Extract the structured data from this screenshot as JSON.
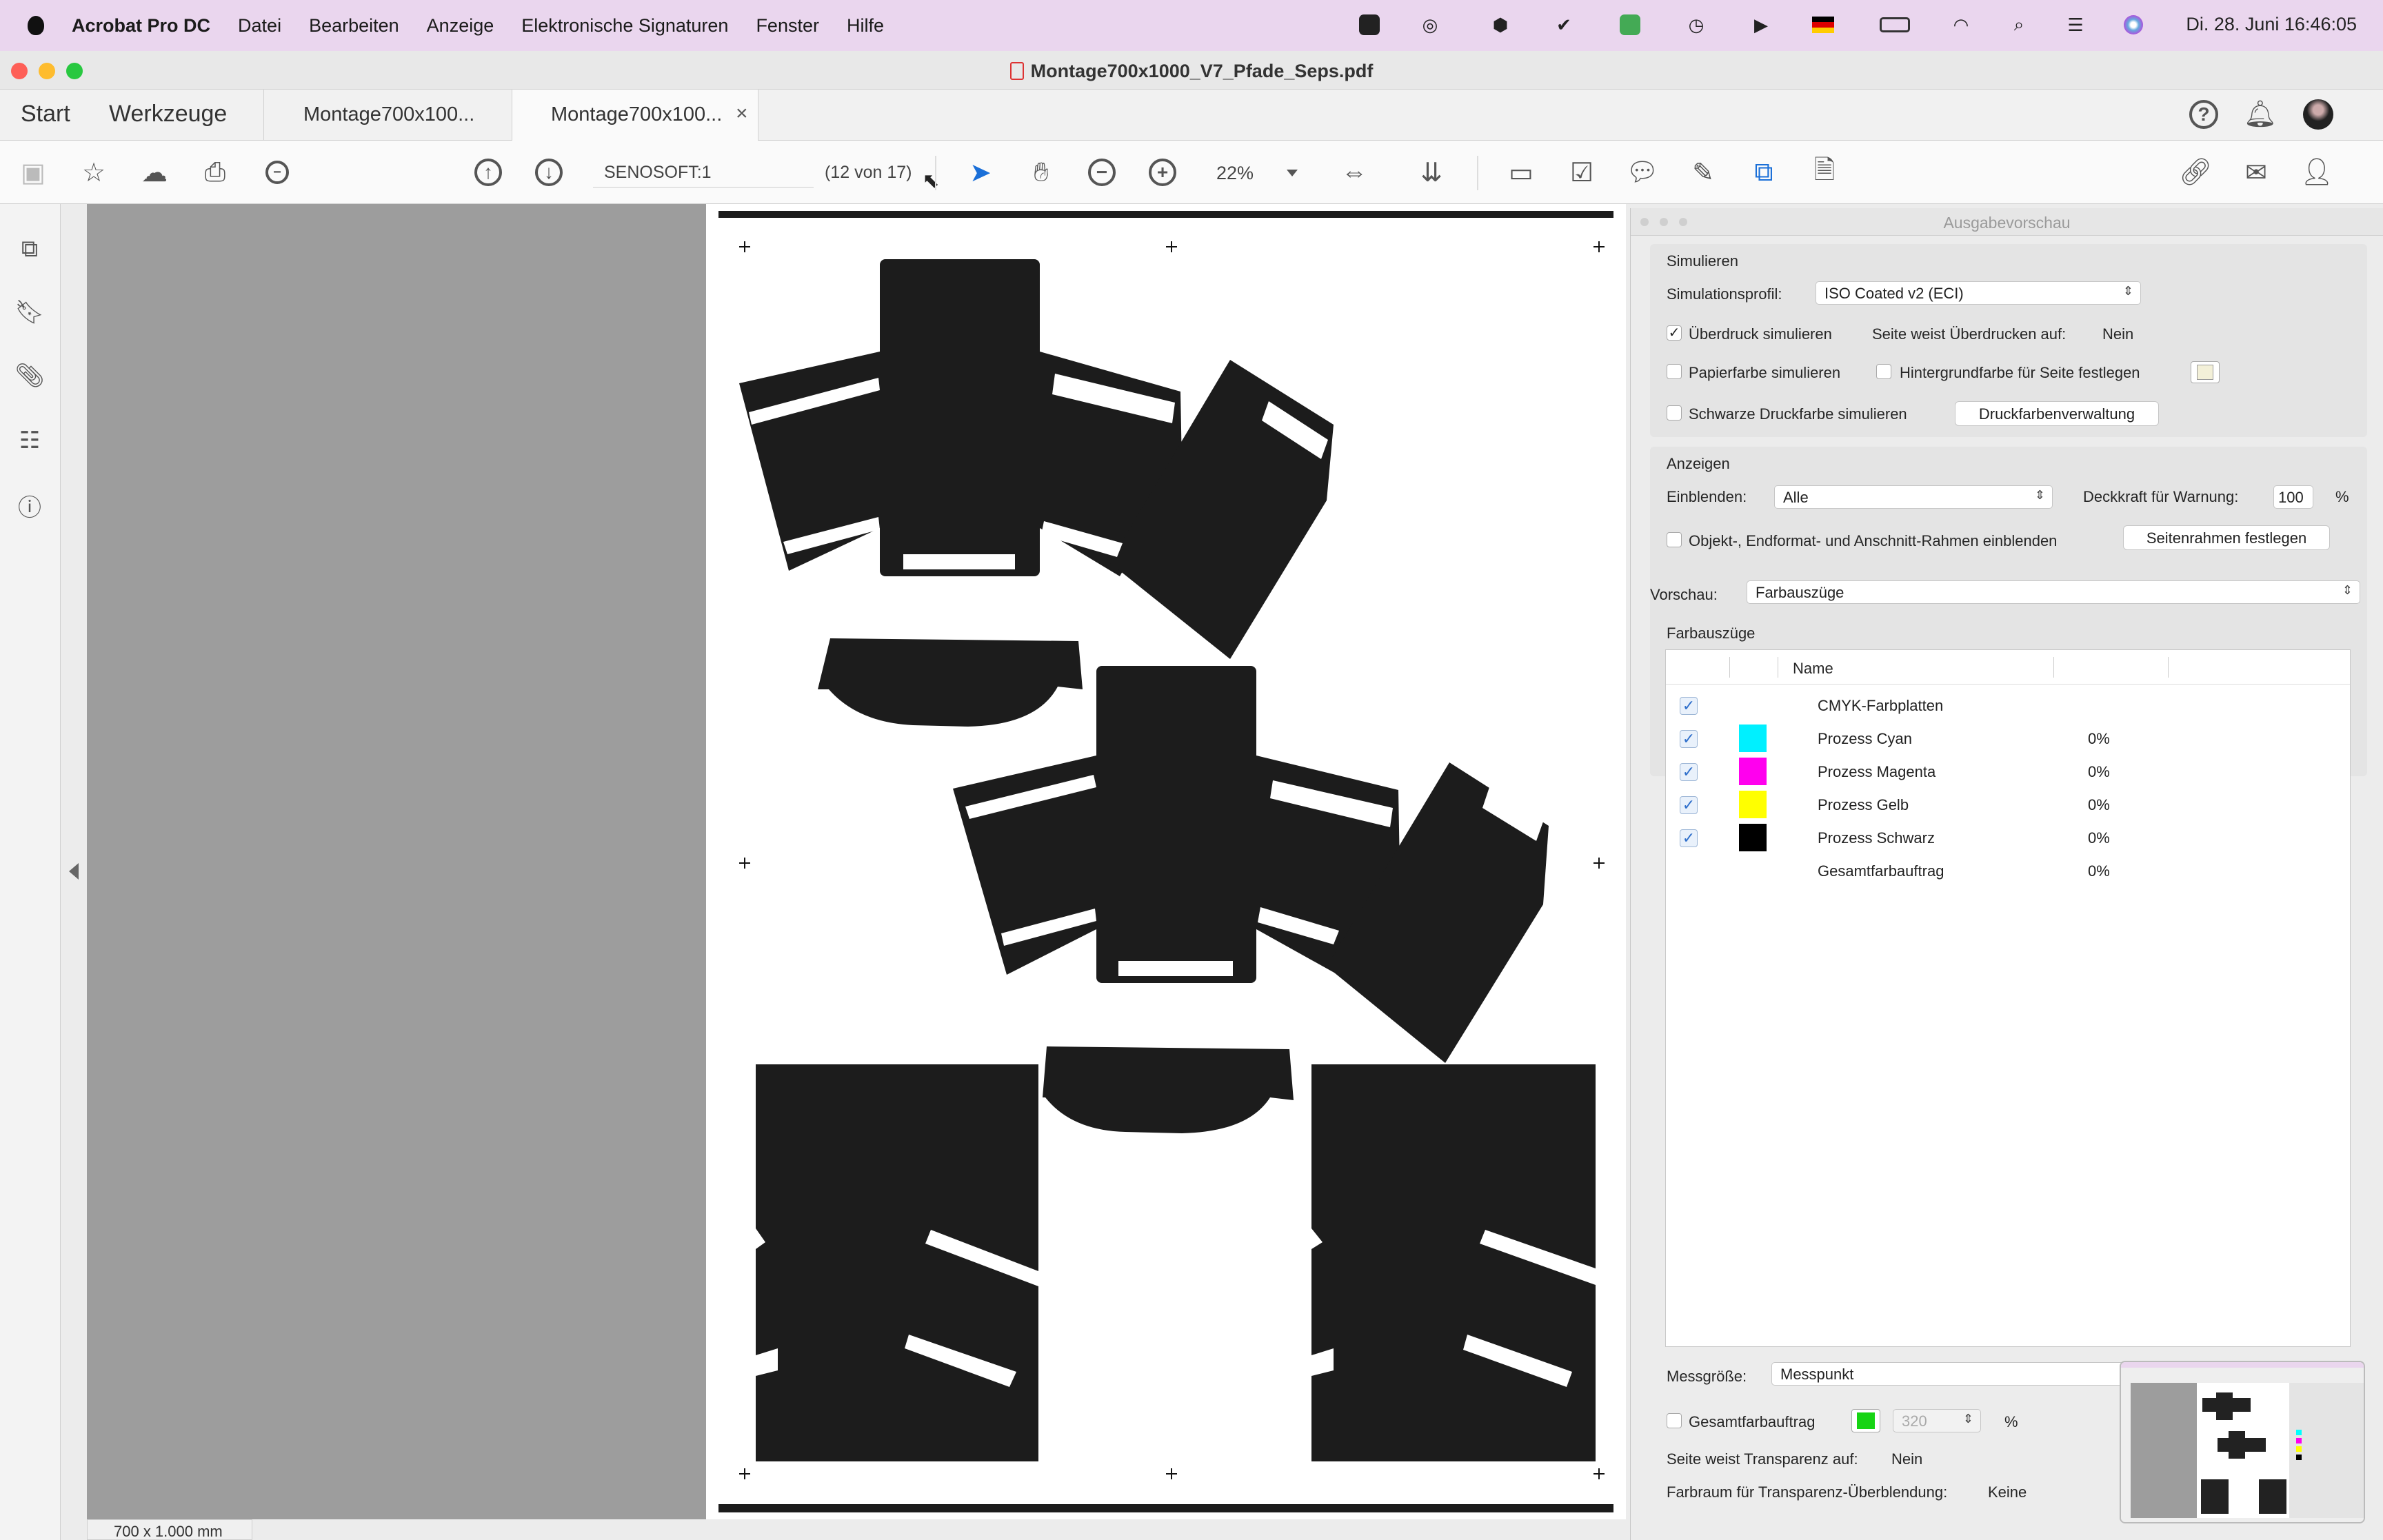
{
  "menubar": {
    "app_name": "Acrobat Pro DC",
    "items": [
      "Datei",
      "Bearbeiten",
      "Anzeige",
      "Elektronische Signaturen",
      "Fenster",
      "Hilfe"
    ],
    "clock": "Di. 28. Juni  16:46:05"
  },
  "window": {
    "title": "Montage700x1000_V7_Pfade_Seps.pdf"
  },
  "tabs": {
    "start": "Start",
    "werkzeuge": "Werkzeuge",
    "doc_tab_1": "Montage700x100...",
    "doc_tab_2": "Montage700x100...",
    "close_symbol": "×"
  },
  "toolbar": {
    "page_label": "SENOSOFT:1",
    "page_count": "(12 von 17)",
    "zoom": "22%"
  },
  "status": {
    "page_size": "700 x 1.000 mm"
  },
  "output_preview": {
    "title": "Ausgabevorschau",
    "simulieren": {
      "section": "Simulieren",
      "profile_label": "Simulationsprofil:",
      "profile_value": "ISO Coated v2 (ECI)",
      "overprint_label": "Überdruck simulieren",
      "overprint_checked": true,
      "page_overprint_label": "Seite weist Überdrucken auf:",
      "page_overprint_value": "Nein",
      "paper_label": "Papierfarbe simulieren",
      "background_label": "Hintergrundfarbe für Seite festlegen",
      "black_ink_label": "Schwarze Druckfarbe simulieren",
      "ink_manager_button": "Druckfarbenverwaltung"
    },
    "anzeigen": {
      "section": "Anzeigen",
      "show_label": "Einblenden:",
      "show_value": "Alle",
      "opacity_label": "Deckkraft für Warnung:",
      "opacity_value": "100",
      "opacity_unit": "%",
      "frames_label": "Objekt-, Endformat- und Anschnitt-Rahmen einblenden",
      "page_frames_button": "Seitenrahmen festlegen"
    },
    "preview_label": "Vorschau:",
    "preview_value": "Farbauszüge",
    "separations": {
      "section": "Farbauszüge",
      "name_header": "Name",
      "rows": [
        {
          "name": "CMYK-Farbplatten",
          "pct": "",
          "checked": true,
          "color": ""
        },
        {
          "name": "Prozess Cyan",
          "pct": "0%",
          "checked": true,
          "color": "#00f0ff"
        },
        {
          "name": "Prozess Magenta",
          "pct": "0%",
          "checked": true,
          "color": "#ff00ee"
        },
        {
          "name": "Prozess Gelb",
          "pct": "0%",
          "checked": true,
          "color": "#ffff00"
        },
        {
          "name": "Prozess Schwarz",
          "pct": "0%",
          "checked": true,
          "color": "#000000"
        },
        {
          "name": "Gesamtfarbauftrag",
          "pct": "0%",
          "checked": false,
          "color": ""
        }
      ]
    },
    "measure_label": "Messgröße:",
    "measure_value": "Messpunkt",
    "total_coverage_label": "Gesamtfarbauftrag",
    "total_coverage_value": "320",
    "total_coverage_unit": "%",
    "transparency_label": "Seite weist Transparenz auf:",
    "transparency_value": "Nein",
    "blend_space_label": "Farbraum für Transparenz-Überblendung:",
    "blend_space_value": "Keine"
  }
}
